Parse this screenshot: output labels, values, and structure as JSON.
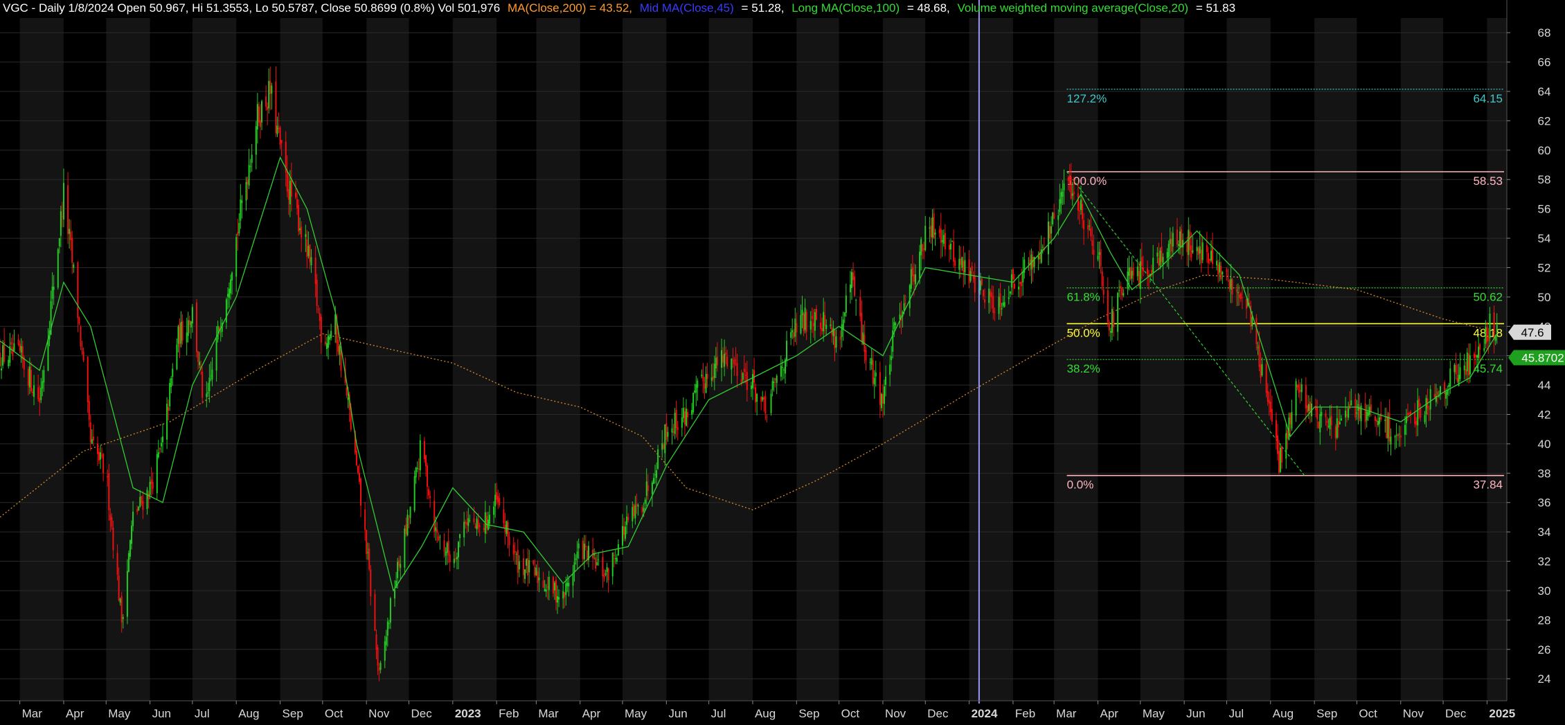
{
  "header": {
    "main": "VGC - Daily 1/8/2024 Open 50.967, Hi 51.3553, Lo 50.5787, Close 50.8699 (0.8%) Vol 501,976",
    "ma200": "MA(Close,200) = 43.52,",
    "mid": "Mid MA(Close,45)",
    "mid_value": "= 51.28,",
    "long": "Long MA(Close,100)",
    "long_value": "= 48.68,",
    "vwma": "Volume weighted moving average(Close,20)",
    "vwma_value": "= 51.83"
  },
  "colors": {
    "background": "#000000",
    "band": "#141414",
    "grid": "#2a2a2a",
    "candle_up": "#22cc22",
    "candle_down": "#ee1111",
    "ma_green": "#32cd32",
    "ma_orange": "#d98a2b",
    "header_text": "#ffffff",
    "header_orange": "#ff9a2e",
    "header_blue": "#3a3aff",
    "header_green": "#33dd33",
    "cursor": "#9999ff",
    "fib_cyan": "#3fc9c9",
    "fib_pink": "#ffb6c1",
    "fib_green": "#33dd33",
    "fib_yellow": "#ffff33"
  },
  "chart_data": {
    "type": "candlestick",
    "title": "VGC - Daily",
    "ylim": [
      22.5,
      69
    ],
    "y_ticks": [
      24,
      26,
      28,
      30,
      32,
      34,
      36,
      38,
      40,
      42,
      44,
      46,
      48,
      50,
      52,
      54,
      56,
      58,
      60,
      62,
      64,
      66,
      68
    ],
    "x_range": [
      "2022-02-15",
      "2025-01-15"
    ],
    "months": [
      {
        "label": "Mar",
        "date": "2022-03-01"
      },
      {
        "label": "Apr",
        "date": "2022-04-01"
      },
      {
        "label": "May",
        "date": "2022-05-01"
      },
      {
        "label": "Jun",
        "date": "2022-06-01"
      },
      {
        "label": "Jul",
        "date": "2022-07-01"
      },
      {
        "label": "Aug",
        "date": "2022-08-01"
      },
      {
        "label": "Sep",
        "date": "2022-09-01"
      },
      {
        "label": "Oct",
        "date": "2022-10-01"
      },
      {
        "label": "Nov",
        "date": "2022-11-01"
      },
      {
        "label": "Dec",
        "date": "2022-12-01"
      },
      {
        "label": "2023",
        "date": "2023-01-01"
      },
      {
        "label": "Feb",
        "date": "2023-02-01"
      },
      {
        "label": "Mar",
        "date": "2023-03-01"
      },
      {
        "label": "Apr",
        "date": "2023-04-01"
      },
      {
        "label": "May",
        "date": "2023-05-01"
      },
      {
        "label": "Jun",
        "date": "2023-06-01"
      },
      {
        "label": "Jul",
        "date": "2023-07-01"
      },
      {
        "label": "Aug",
        "date": "2023-08-01"
      },
      {
        "label": "Sep",
        "date": "2023-09-01"
      },
      {
        "label": "Oct",
        "date": "2023-10-01"
      },
      {
        "label": "Nov",
        "date": "2023-11-01"
      },
      {
        "label": "Dec",
        "date": "2023-12-01"
      },
      {
        "label": "2024",
        "date": "2024-01-01"
      },
      {
        "label": "Feb",
        "date": "2024-02-01"
      },
      {
        "label": "Mar",
        "date": "2024-03-01"
      },
      {
        "label": "Apr",
        "date": "2024-04-01"
      },
      {
        "label": "May",
        "date": "2024-05-01"
      },
      {
        "label": "Jun",
        "date": "2024-06-01"
      },
      {
        "label": "Jul",
        "date": "2024-07-01"
      },
      {
        "label": "Aug",
        "date": "2024-08-01"
      },
      {
        "label": "Sep",
        "date": "2024-09-01"
      },
      {
        "label": "Oct",
        "date": "2024-10-01"
      },
      {
        "label": "Nov",
        "date": "2024-11-01"
      },
      {
        "label": "Dec",
        "date": "2024-12-01"
      },
      {
        "label": "2025",
        "date": "2025-01-01"
      }
    ],
    "price_path": [
      [
        "2022-02-15",
        46
      ],
      [
        "2022-03-01",
        46
      ],
      [
        "2022-03-15",
        43
      ],
      [
        "2022-03-25",
        51
      ],
      [
        "2022-04-01",
        57
      ],
      [
        "2022-04-10",
        50
      ],
      [
        "2022-04-20",
        40
      ],
      [
        "2022-05-01",
        38
      ],
      [
        "2022-05-12",
        28
      ],
      [
        "2022-05-20",
        35
      ],
      [
        "2022-06-01",
        37
      ],
      [
        "2022-06-10",
        40
      ],
      [
        "2022-06-20",
        47
      ],
      [
        "2022-07-01",
        49
      ],
      [
        "2022-07-10",
        42
      ],
      [
        "2022-07-20",
        48
      ],
      [
        "2022-08-01",
        54
      ],
      [
        "2022-08-15",
        62
      ],
      [
        "2022-08-25",
        64
      ],
      [
        "2022-09-05",
        58
      ],
      [
        "2022-09-15",
        55
      ],
      [
        "2022-09-25",
        51
      ],
      [
        "2022-10-01",
        47
      ],
      [
        "2022-10-10",
        48
      ],
      [
        "2022-10-20",
        42
      ],
      [
        "2022-11-01",
        33
      ],
      [
        "2022-11-10",
        24
      ],
      [
        "2022-11-20",
        30
      ],
      [
        "2022-12-01",
        35
      ],
      [
        "2022-12-10",
        40
      ],
      [
        "2022-12-20",
        34
      ],
      [
        "2023-01-01",
        32
      ],
      [
        "2023-01-10",
        35
      ],
      [
        "2023-01-20",
        34
      ],
      [
        "2023-02-01",
        36
      ],
      [
        "2023-02-15",
        32
      ],
      [
        "2023-03-01",
        31
      ],
      [
        "2023-03-20",
        29.5
      ],
      [
        "2023-04-01",
        33
      ],
      [
        "2023-04-10",
        32
      ],
      [
        "2023-04-20",
        31
      ],
      [
        "2023-05-01",
        34
      ],
      [
        "2023-05-15",
        36
      ],
      [
        "2023-06-01",
        41
      ],
      [
        "2023-06-15",
        42
      ],
      [
        "2023-07-01",
        45
      ],
      [
        "2023-07-15",
        46
      ],
      [
        "2023-08-01",
        44
      ],
      [
        "2023-08-10",
        42
      ],
      [
        "2023-08-20",
        45
      ],
      [
        "2023-09-01",
        48
      ],
      [
        "2023-09-15",
        49
      ],
      [
        "2023-10-01",
        47
      ],
      [
        "2023-10-10",
        51
      ],
      [
        "2023-10-20",
        46
      ],
      [
        "2023-11-01",
        43
      ],
      [
        "2023-11-10",
        48
      ],
      [
        "2023-11-20",
        51
      ],
      [
        "2023-12-01",
        54
      ],
      [
        "2023-12-10",
        55
      ],
      [
        "2023-12-20",
        53
      ],
      [
        "2024-01-01",
        51.5
      ],
      [
        "2024-01-10",
        50.5
      ],
      [
        "2024-01-20",
        49.5
      ],
      [
        "2024-02-01",
        51
      ],
      [
        "2024-02-15",
        52.5
      ],
      [
        "2024-03-01",
        55
      ],
      [
        "2024-03-10",
        58
      ],
      [
        "2024-03-20",
        56
      ],
      [
        "2024-04-01",
        53
      ],
      [
        "2024-04-10",
        48
      ],
      [
        "2024-04-20",
        51
      ],
      [
        "2024-05-01",
        51.5
      ],
      [
        "2024-05-15",
        53
      ],
      [
        "2024-06-01",
        54
      ],
      [
        "2024-06-15",
        53
      ],
      [
        "2024-07-01",
        51
      ],
      [
        "2024-07-15",
        50
      ],
      [
        "2024-08-01",
        42
      ],
      [
        "2024-08-07",
        38.5
      ],
      [
        "2024-08-20",
        44
      ],
      [
        "2024-09-01",
        42
      ],
      [
        "2024-09-15",
        41
      ],
      [
        "2024-10-01",
        42.5
      ],
      [
        "2024-10-15",
        41.5
      ],
      [
        "2024-11-01",
        40.5
      ],
      [
        "2024-11-15",
        42.5
      ],
      [
        "2024-12-01",
        44
      ],
      [
        "2024-12-20",
        45.5
      ],
      [
        "2025-01-03",
        48
      ],
      [
        "2025-01-08",
        47.6
      ]
    ],
    "ma_green_path": [
      [
        "2022-02-15",
        47
      ],
      [
        "2022-03-15",
        45
      ],
      [
        "2022-04-01",
        51
      ],
      [
        "2022-04-20",
        48
      ],
      [
        "2022-05-20",
        37
      ],
      [
        "2022-06-10",
        36
      ],
      [
        "2022-07-01",
        44
      ],
      [
        "2022-08-01",
        50
      ],
      [
        "2022-09-01",
        59.5
      ],
      [
        "2022-09-20",
        56
      ],
      [
        "2022-10-10",
        49
      ],
      [
        "2022-10-25",
        40
      ],
      [
        "2022-11-20",
        30
      ],
      [
        "2022-12-10",
        33
      ],
      [
        "2023-01-01",
        37
      ],
      [
        "2023-01-25",
        34.5
      ],
      [
        "2023-02-20",
        34
      ],
      [
        "2023-03-20",
        30.5
      ],
      [
        "2023-04-10",
        32.5
      ],
      [
        "2023-05-05",
        33
      ],
      [
        "2023-06-01",
        38.5
      ],
      [
        "2023-07-01",
        43
      ],
      [
        "2023-08-01",
        44.5
      ],
      [
        "2023-09-01",
        46
      ],
      [
        "2023-10-01",
        48
      ],
      [
        "2023-11-01",
        46
      ],
      [
        "2023-12-01",
        52
      ],
      [
        "2024-01-01",
        51.5
      ],
      [
        "2024-02-01",
        51
      ],
      [
        "2024-03-01",
        54
      ],
      [
        "2024-03-20",
        57
      ],
      [
        "2024-04-10",
        53
      ],
      [
        "2024-04-25",
        50.5
      ],
      [
        "2024-05-15",
        52
      ],
      [
        "2024-06-10",
        54.5
      ],
      [
        "2024-07-10",
        51.5
      ],
      [
        "2024-07-25",
        47
      ],
      [
        "2024-08-15",
        40.5
      ],
      [
        "2024-09-01",
        42.5
      ],
      [
        "2024-10-01",
        42.5
      ],
      [
        "2024-11-01",
        41.5
      ],
      [
        "2024-12-01",
        43.5
      ],
      [
        "2024-12-20",
        44.5
      ],
      [
        "2025-01-08",
        47.5
      ]
    ],
    "ma200_path": [
      [
        "2022-02-15",
        35
      ],
      [
        "2022-04-15",
        39.5
      ],
      [
        "2022-06-15",
        41.5
      ],
      [
        "2022-08-15",
        45
      ],
      [
        "2022-10-01",
        47.5
      ],
      [
        "2022-11-15",
        46.5
      ],
      [
        "2023-01-01",
        45.5
      ],
      [
        "2023-02-15",
        43.5
      ],
      [
        "2023-04-01",
        42.5
      ],
      [
        "2023-05-15",
        40.5
      ],
      [
        "2023-06-15",
        37
      ],
      [
        "2023-08-01",
        35.5
      ],
      [
        "2023-09-15",
        37.5
      ],
      [
        "2023-11-01",
        40
      ],
      [
        "2024-01-01",
        43.5
      ],
      [
        "2024-02-15",
        46
      ],
      [
        "2024-04-01",
        48.5
      ],
      [
        "2024-05-15",
        50.5
      ],
      [
        "2024-06-15",
        51.5
      ],
      [
        "2024-08-01",
        51.2
      ],
      [
        "2024-10-01",
        50.5
      ],
      [
        "2024-12-01",
        48.5
      ],
      [
        "2025-01-08",
        47.6
      ]
    ],
    "fib_levels": [
      {
        "pct": "127.2%",
        "price": 64.15,
        "value_label": "64.15",
        "color": "#3fc9c9",
        "line": "dotted"
      },
      {
        "pct": "100.0%",
        "price": 58.53,
        "value_label": "58.53",
        "color": "#ffb6c1",
        "line": "solid"
      },
      {
        "pct": "61.8%",
        "price": 50.62,
        "value_label": "50.62",
        "color": "#33dd33",
        "line": "dotted"
      },
      {
        "pct": "50.0%",
        "price": 48.18,
        "value_label": "48.18",
        "color": "#ffff33",
        "line": "solid"
      },
      {
        "pct": "38.2%",
        "price": 45.74,
        "value_label": "45.74",
        "color": "#33dd33",
        "line": "dotted"
      },
      {
        "pct": "0.0%",
        "price": 37.84,
        "value_label": "37.84",
        "color": "#ffb6c1",
        "line": "solid"
      }
    ],
    "fib_start": "2024-03-10",
    "trend_line": {
      "from": [
        "2024-03-10",
        58.53
      ],
      "to": [
        "2024-08-25",
        37.84
      ]
    },
    "cursor_date": "2024-01-08",
    "last_price": {
      "label": "47.6",
      "value": 47.6
    },
    "ma_price": {
      "label": "45.8702",
      "value": 45.8702
    }
  }
}
